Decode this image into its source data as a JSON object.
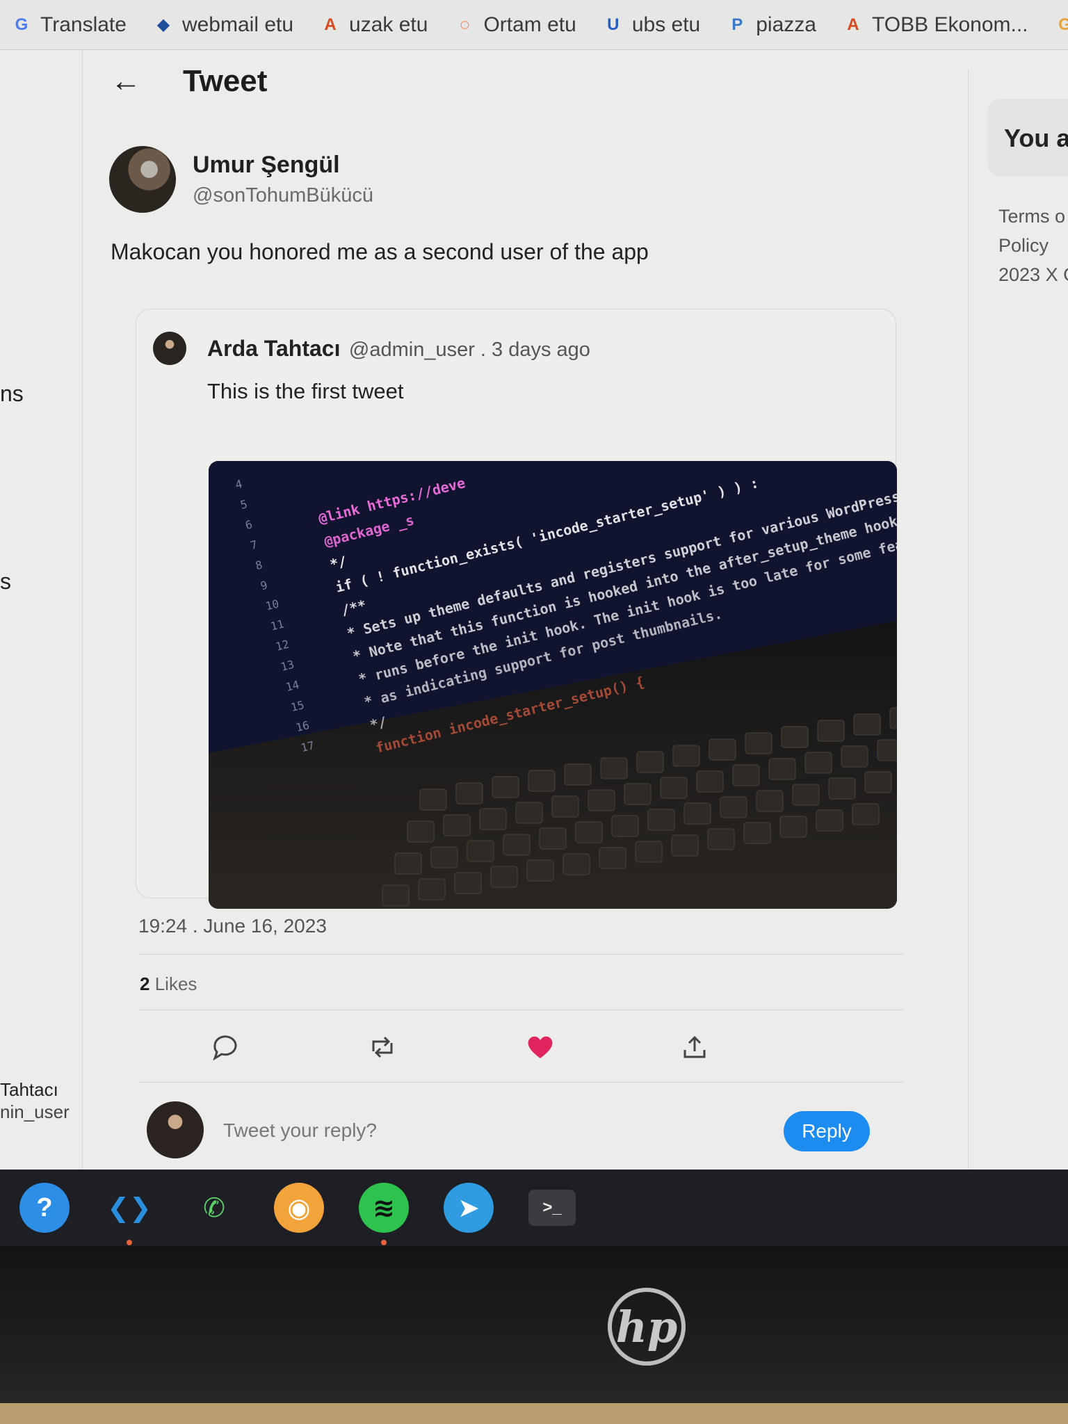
{
  "bookmarks": [
    {
      "label": "Translate",
      "icon": "translate-icon",
      "color": "#4a7cf0",
      "glyph": "G"
    },
    {
      "label": "webmail etu",
      "icon": "webmail-icon",
      "color": "#1d4f9c",
      "glyph": "◆"
    },
    {
      "label": "uzak etu",
      "icon": "moodle-icon",
      "color": "#d64a1f",
      "glyph": "A"
    },
    {
      "label": "Ortam etu",
      "icon": "ortam-icon",
      "color": "#e25822",
      "glyph": "◌"
    },
    {
      "label": "ubs etu",
      "icon": "ubs-icon",
      "color": "#2460c8",
      "glyph": "U"
    },
    {
      "label": "piazza",
      "icon": "piazza-icon",
      "color": "#3a78c4",
      "glyph": "P"
    },
    {
      "label": "TOBB Ekonom...",
      "icon": "tobb-icon",
      "color": "#d64a1f",
      "glyph": "A"
    },
    {
      "label": "G",
      "icon": "google-icon",
      "color": "#e8a33a",
      "glyph": ""
    }
  ],
  "sidebar_fragments": {
    "frag1": "ns",
    "frag2": "s",
    "user_name": "Tahtacı",
    "user_handle": "nin_user"
  },
  "header": {
    "title": "Tweet"
  },
  "tweet": {
    "author_name": "Umur Şengül",
    "author_handle": "@sonTohumBükücü",
    "text": "Makocan you honored me as a second user of the app",
    "timestamp": "19:24 . June 16, 2023",
    "likes_count": "2",
    "likes_label": "Likes"
  },
  "quoted": {
    "author_name": "Arda Tahtacı",
    "meta": "@admin_user . 3 days ago",
    "text": "This is the first tweet",
    "image_code_lines": [
      "@link https://deve",
      "@package _s",
      "*/",
      "if ( ! function_exists( 'incode_starter_setup' ) ) :",
      "/**",
      " * Sets up theme defaults and registers support for various WordPress",
      " * Note that this function is hooked into the after_setup_theme hook",
      " * runs before the init hook. The init hook is too late for some features",
      " * as indicating support for post thumbnails.",
      " */",
      "function incode_starter_setup() {"
    ],
    "image_line_numbers": [
      "4",
      "5",
      "6",
      "7",
      "8",
      "9",
      "10",
      "11",
      "12",
      "13",
      "14",
      "15",
      "16",
      "17"
    ]
  },
  "actions": {
    "liked_color": "#e0245e"
  },
  "reply": {
    "placeholder": "Tweet your reply?",
    "button_label": "Reply"
  },
  "right_panel": {
    "title": "You a",
    "links": [
      "Terms o",
      "Policy",
      "2023 X C"
    ]
  },
  "taskbar": [
    {
      "name": "help-app",
      "glyph": "?",
      "bg": "#2d8ee8",
      "fg": "#ffffff",
      "dot": false
    },
    {
      "name": "vscode-app",
      "glyph": "❮❯",
      "bg": "transparent",
      "fg": "#2b8fe0",
      "dot": true
    },
    {
      "name": "whatsapp-app",
      "glyph": "✆",
      "bg": "transparent",
      "fg": "#5fcf6a",
      "dot": false
    },
    {
      "name": "discord-app",
      "glyph": "◉",
      "bg": "#f2a33a",
      "fg": "#ffffff",
      "dot": false
    },
    {
      "name": "spotify-app",
      "glyph": "≋",
      "bg": "#2ec24f",
      "fg": "#111111",
      "dot": true
    },
    {
      "name": "telegram-app",
      "glyph": "➤",
      "bg": "#2f9be0",
      "fg": "#ffffff",
      "dot": false
    },
    {
      "name": "terminal-app",
      "glyph": ">_",
      "bg": "#3a3c40",
      "fg": "#e8e8e8",
      "dot": false
    }
  ],
  "brand": {
    "logo": "hp"
  }
}
